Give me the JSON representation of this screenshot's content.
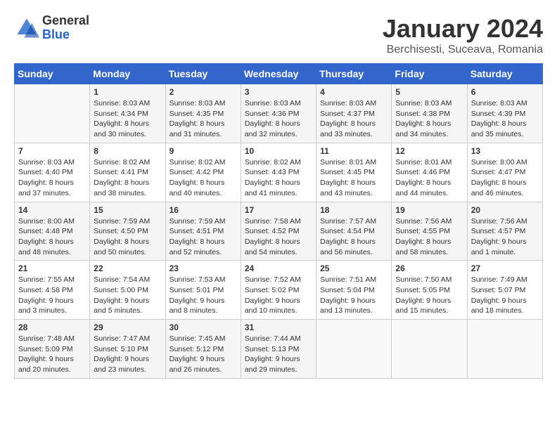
{
  "logo": {
    "general": "General",
    "blue": "Blue"
  },
  "title": "January 2024",
  "location": "Berchisesti, Suceava, Romania",
  "days_of_week": [
    "Sunday",
    "Monday",
    "Tuesday",
    "Wednesday",
    "Thursday",
    "Friday",
    "Saturday"
  ],
  "weeks": [
    [
      {
        "day": "",
        "sunrise": "",
        "sunset": "",
        "daylight": ""
      },
      {
        "day": "1",
        "sunrise": "Sunrise: 8:03 AM",
        "sunset": "Sunset: 4:34 PM",
        "daylight": "Daylight: 8 hours and 30 minutes."
      },
      {
        "day": "2",
        "sunrise": "Sunrise: 8:03 AM",
        "sunset": "Sunset: 4:35 PM",
        "daylight": "Daylight: 8 hours and 31 minutes."
      },
      {
        "day": "3",
        "sunrise": "Sunrise: 8:03 AM",
        "sunset": "Sunset: 4:36 PM",
        "daylight": "Daylight: 8 hours and 32 minutes."
      },
      {
        "day": "4",
        "sunrise": "Sunrise: 8:03 AM",
        "sunset": "Sunset: 4:37 PM",
        "daylight": "Daylight: 8 hours and 33 minutes."
      },
      {
        "day": "5",
        "sunrise": "Sunrise: 8:03 AM",
        "sunset": "Sunset: 4:38 PM",
        "daylight": "Daylight: 8 hours and 34 minutes."
      },
      {
        "day": "6",
        "sunrise": "Sunrise: 8:03 AM",
        "sunset": "Sunset: 4:39 PM",
        "daylight": "Daylight: 8 hours and 35 minutes."
      }
    ],
    [
      {
        "day": "7",
        "sunrise": "Sunrise: 8:03 AM",
        "sunset": "Sunset: 4:40 PM",
        "daylight": "Daylight: 8 hours and 37 minutes."
      },
      {
        "day": "8",
        "sunrise": "Sunrise: 8:02 AM",
        "sunset": "Sunset: 4:41 PM",
        "daylight": "Daylight: 8 hours and 38 minutes."
      },
      {
        "day": "9",
        "sunrise": "Sunrise: 8:02 AM",
        "sunset": "Sunset: 4:42 PM",
        "daylight": "Daylight: 8 hours and 40 minutes."
      },
      {
        "day": "10",
        "sunrise": "Sunrise: 8:02 AM",
        "sunset": "Sunset: 4:43 PM",
        "daylight": "Daylight: 8 hours and 41 minutes."
      },
      {
        "day": "11",
        "sunrise": "Sunrise: 8:01 AM",
        "sunset": "Sunset: 4:45 PM",
        "daylight": "Daylight: 8 hours and 43 minutes."
      },
      {
        "day": "12",
        "sunrise": "Sunrise: 8:01 AM",
        "sunset": "Sunset: 4:46 PM",
        "daylight": "Daylight: 8 hours and 44 minutes."
      },
      {
        "day": "13",
        "sunrise": "Sunrise: 8:00 AM",
        "sunset": "Sunset: 4:47 PM",
        "daylight": "Daylight: 8 hours and 46 minutes."
      }
    ],
    [
      {
        "day": "14",
        "sunrise": "Sunrise: 8:00 AM",
        "sunset": "Sunset: 4:48 PM",
        "daylight": "Daylight: 8 hours and 48 minutes."
      },
      {
        "day": "15",
        "sunrise": "Sunrise: 7:59 AM",
        "sunset": "Sunset: 4:50 PM",
        "daylight": "Daylight: 8 hours and 50 minutes."
      },
      {
        "day": "16",
        "sunrise": "Sunrise: 7:59 AM",
        "sunset": "Sunset: 4:51 PM",
        "daylight": "Daylight: 8 hours and 52 minutes."
      },
      {
        "day": "17",
        "sunrise": "Sunrise: 7:58 AM",
        "sunset": "Sunset: 4:52 PM",
        "daylight": "Daylight: 8 hours and 54 minutes."
      },
      {
        "day": "18",
        "sunrise": "Sunrise: 7:57 AM",
        "sunset": "Sunset: 4:54 PM",
        "daylight": "Daylight: 8 hours and 56 minutes."
      },
      {
        "day": "19",
        "sunrise": "Sunrise: 7:56 AM",
        "sunset": "Sunset: 4:55 PM",
        "daylight": "Daylight: 8 hours and 58 minutes."
      },
      {
        "day": "20",
        "sunrise": "Sunrise: 7:56 AM",
        "sunset": "Sunset: 4:57 PM",
        "daylight": "Daylight: 9 hours and 1 minute."
      }
    ],
    [
      {
        "day": "21",
        "sunrise": "Sunrise: 7:55 AM",
        "sunset": "Sunset: 4:58 PM",
        "daylight": "Daylight: 9 hours and 3 minutes."
      },
      {
        "day": "22",
        "sunrise": "Sunrise: 7:54 AM",
        "sunset": "Sunset: 5:00 PM",
        "daylight": "Daylight: 9 hours and 5 minutes."
      },
      {
        "day": "23",
        "sunrise": "Sunrise: 7:53 AM",
        "sunset": "Sunset: 5:01 PM",
        "daylight": "Daylight: 9 hours and 8 minutes."
      },
      {
        "day": "24",
        "sunrise": "Sunrise: 7:52 AM",
        "sunset": "Sunset: 5:02 PM",
        "daylight": "Daylight: 9 hours and 10 minutes."
      },
      {
        "day": "25",
        "sunrise": "Sunrise: 7:51 AM",
        "sunset": "Sunset: 5:04 PM",
        "daylight": "Daylight: 9 hours and 13 minutes."
      },
      {
        "day": "26",
        "sunrise": "Sunrise: 7:50 AM",
        "sunset": "Sunset: 5:05 PM",
        "daylight": "Daylight: 9 hours and 15 minutes."
      },
      {
        "day": "27",
        "sunrise": "Sunrise: 7:49 AM",
        "sunset": "Sunset: 5:07 PM",
        "daylight": "Daylight: 9 hours and 18 minutes."
      }
    ],
    [
      {
        "day": "28",
        "sunrise": "Sunrise: 7:48 AM",
        "sunset": "Sunset: 5:09 PM",
        "daylight": "Daylight: 9 hours and 20 minutes."
      },
      {
        "day": "29",
        "sunrise": "Sunrise: 7:47 AM",
        "sunset": "Sunset: 5:10 PM",
        "daylight": "Daylight: 9 hours and 23 minutes."
      },
      {
        "day": "30",
        "sunrise": "Sunrise: 7:45 AM",
        "sunset": "Sunset: 5:12 PM",
        "daylight": "Daylight: 9 hours and 26 minutes."
      },
      {
        "day": "31",
        "sunrise": "Sunrise: 7:44 AM",
        "sunset": "Sunset: 5:13 PM",
        "daylight": "Daylight: 9 hours and 29 minutes."
      },
      {
        "day": "",
        "sunrise": "",
        "sunset": "",
        "daylight": ""
      },
      {
        "day": "",
        "sunrise": "",
        "sunset": "",
        "daylight": ""
      },
      {
        "day": "",
        "sunrise": "",
        "sunset": "",
        "daylight": ""
      }
    ]
  ]
}
